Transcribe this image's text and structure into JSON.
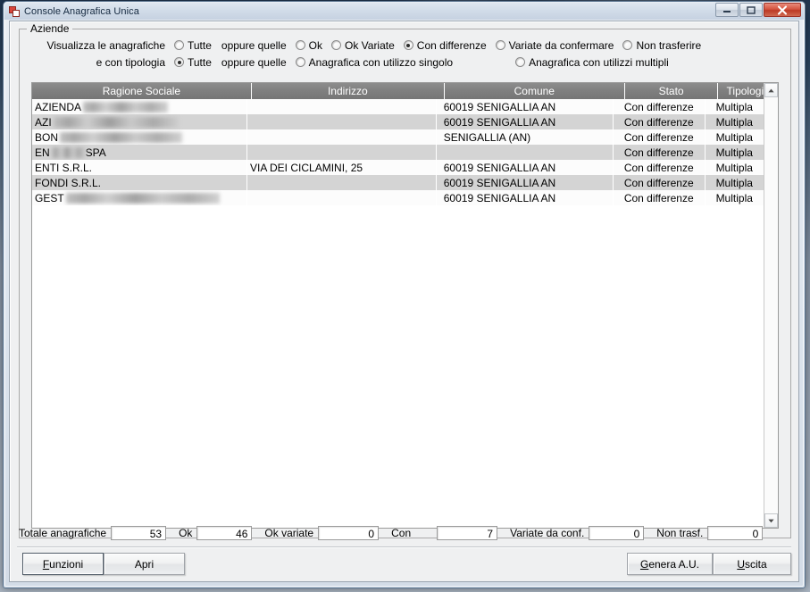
{
  "window": {
    "title": "Console Anagrafica Unica",
    "icon": "app-icon",
    "controls": {
      "minimize": "minimize-icon",
      "maximize": "maximize-icon",
      "close": "close-icon"
    }
  },
  "group": {
    "legend": "Aziende"
  },
  "filters": {
    "row1": {
      "lead_label": "Visualizza le anagrafiche",
      "options": [
        {
          "label": "Tutte",
          "checked": false
        },
        {
          "label": "Ok",
          "checked": false
        },
        {
          "label": "Ok Variate",
          "checked": false
        },
        {
          "label": "Con differenze",
          "checked": true
        },
        {
          "label": "Variate da confermare",
          "checked": false
        },
        {
          "label": "Non trasferire",
          "checked": false
        }
      ],
      "separator_text": "oppure quelle"
    },
    "row2": {
      "lead_label": "e con tipologia",
      "options": [
        {
          "label": "Tutte",
          "checked": true
        },
        {
          "label": "Anagrafica con utilizzo singolo",
          "checked": false
        },
        {
          "label": "Anagrafica con utilizzi multipli",
          "checked": false
        }
      ],
      "separator_text": "oppure quelle"
    }
  },
  "grid": {
    "columns": [
      "Ragione Sociale",
      "Indirizzo",
      "Comune",
      "Stato",
      "Tipologia"
    ],
    "rows": [
      {
        "ragione_sociale": "AZIENDA",
        "redacted_width": 95,
        "indirizzo": "",
        "comune": "60019 SENIGALLIA AN",
        "stato": "Con differenze",
        "tipologia": "Multipla"
      },
      {
        "ragione_sociale": "AZI",
        "redacted_width": 140,
        "indirizzo": "",
        "comune": "60019 SENIGALLIA AN",
        "stato": "Con differenze",
        "tipologia": "Multipla"
      },
      {
        "ragione_sociale": "BON",
        "redacted_width": 137,
        "indirizzo": "",
        "comune": "SENIGALLIA (AN)",
        "stato": "Con differenze",
        "tipologia": "Multipla"
      },
      {
        "ragione_sociale": "EN",
        "redacted_width": 38,
        "ragione_sociale_suffix": "SPA",
        "indirizzo": "",
        "comune": "",
        "stato": "Con differenze",
        "tipologia": "Multipla"
      },
      {
        "ragione_sociale": "ENTI S.R.L.",
        "redacted_width": 0,
        "indirizzo": "VIA DEI CICLAMINI, 25",
        "comune": "60019 SENIGALLIA AN",
        "stato": "Con differenze",
        "tipologia": "Multipla"
      },
      {
        "ragione_sociale": "FONDI S.R.L.",
        "redacted_width": 0,
        "indirizzo": "",
        "comune": "60019 SENIGALLIA AN",
        "stato": "Con differenze",
        "tipologia": "Multipla"
      },
      {
        "ragione_sociale": "GEST",
        "redacted_width": 172,
        "indirizzo": "",
        "comune": "60019 SENIGALLIA AN",
        "stato": "Con differenze",
        "tipologia": "Multipla"
      }
    ],
    "scrollbar": {
      "up_arrow": "scroll-up-icon",
      "down_arrow": "scroll-down-icon"
    }
  },
  "counters": [
    {
      "label": "Totale anagrafiche",
      "value": "53"
    },
    {
      "label": "Ok",
      "value": "46"
    },
    {
      "label": "Ok variate",
      "value": "0"
    },
    {
      "label": "Con",
      "value": "7"
    },
    {
      "label": "Variate da conf.",
      "value": "0"
    },
    {
      "label": "Non trasf.",
      "value": "0"
    }
  ],
  "buttons": {
    "funzioni": {
      "mnemonic": "F",
      "rest": "unzioni"
    },
    "apri": "Apri",
    "genera": {
      "mnemonic": "G",
      "rest": "enera A.U."
    },
    "uscita": {
      "mnemonic": "U",
      "rest": "scita"
    }
  }
}
